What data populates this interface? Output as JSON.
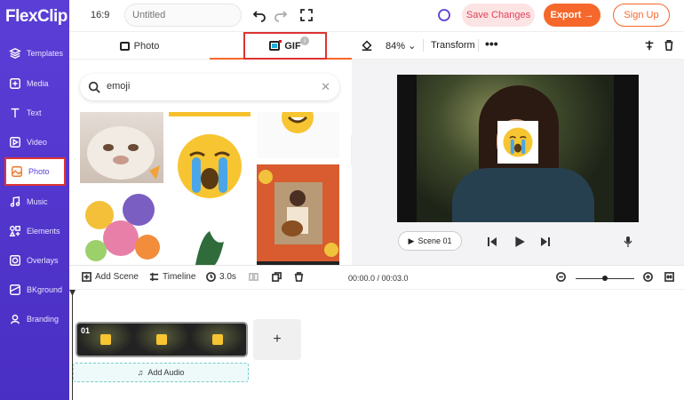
{
  "app": {
    "logo": "FlexClip"
  },
  "sidebar": {
    "items": [
      {
        "label": "Templates",
        "icon": "layers-icon"
      },
      {
        "label": "Media",
        "icon": "media-icon"
      },
      {
        "label": "Text",
        "icon": "text-icon"
      },
      {
        "label": "Video",
        "icon": "video-icon"
      },
      {
        "label": "Photo",
        "icon": "photo-icon",
        "active": true
      },
      {
        "label": "Music",
        "icon": "music-icon"
      },
      {
        "label": "Elements",
        "icon": "elements-icon"
      },
      {
        "label": "Overlays",
        "icon": "overlays-icon"
      },
      {
        "label": "BKground",
        "icon": "background-icon"
      },
      {
        "label": "Branding",
        "icon": "branding-icon"
      }
    ]
  },
  "topbar": {
    "ratio": "16:9",
    "title_placeholder": "Untitled",
    "save_label": "Save Changes",
    "export_label": "Export →",
    "signup_label": "Sign Up"
  },
  "panel": {
    "tab_photo": "Photo",
    "tab_gif": "GIF",
    "search_value": "emoji"
  },
  "editor": {
    "zoom": "84%",
    "transform_label": "Transform",
    "scene_label": "Scene 01"
  },
  "timeline": {
    "add_scene": "Add Scene",
    "timeline_label": "Timeline",
    "duration": "3.0s",
    "time": "00:00.0 / 00:03.0",
    "clip_number": "01",
    "add_audio": "Add Audio"
  },
  "colors": {
    "accent": "#f5672b",
    "sidebar": "#5b3ed6",
    "highlight": "#dd3333"
  }
}
